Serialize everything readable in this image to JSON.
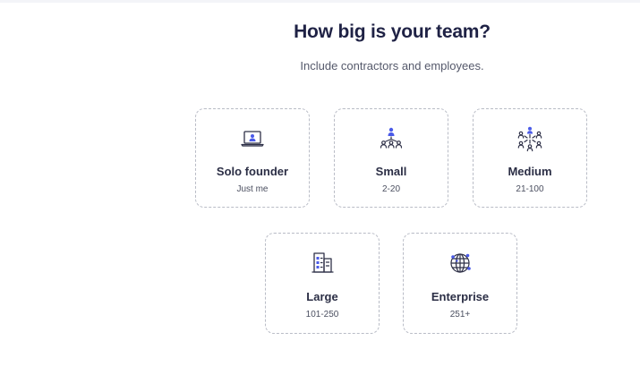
{
  "header": {
    "title": "How big is your team?",
    "subtitle": "Include contractors and employees."
  },
  "options": [
    {
      "label": "Solo founder",
      "range": "Just me",
      "icon": "laptop-user-icon"
    },
    {
      "label": "Small",
      "range": "2-20",
      "icon": "small-team-icon"
    },
    {
      "label": "Medium",
      "range": "21-100",
      "icon": "medium-team-icon"
    },
    {
      "label": "Large",
      "range": "101-250",
      "icon": "office-building-icon"
    },
    {
      "label": "Enterprise",
      "range": "251+",
      "icon": "globe-network-icon"
    }
  ],
  "colors": {
    "accent": "#4a5ae8",
    "icon_stroke": "#2f3148",
    "title": "#1f2245",
    "card_border": "#b9bcc6"
  }
}
